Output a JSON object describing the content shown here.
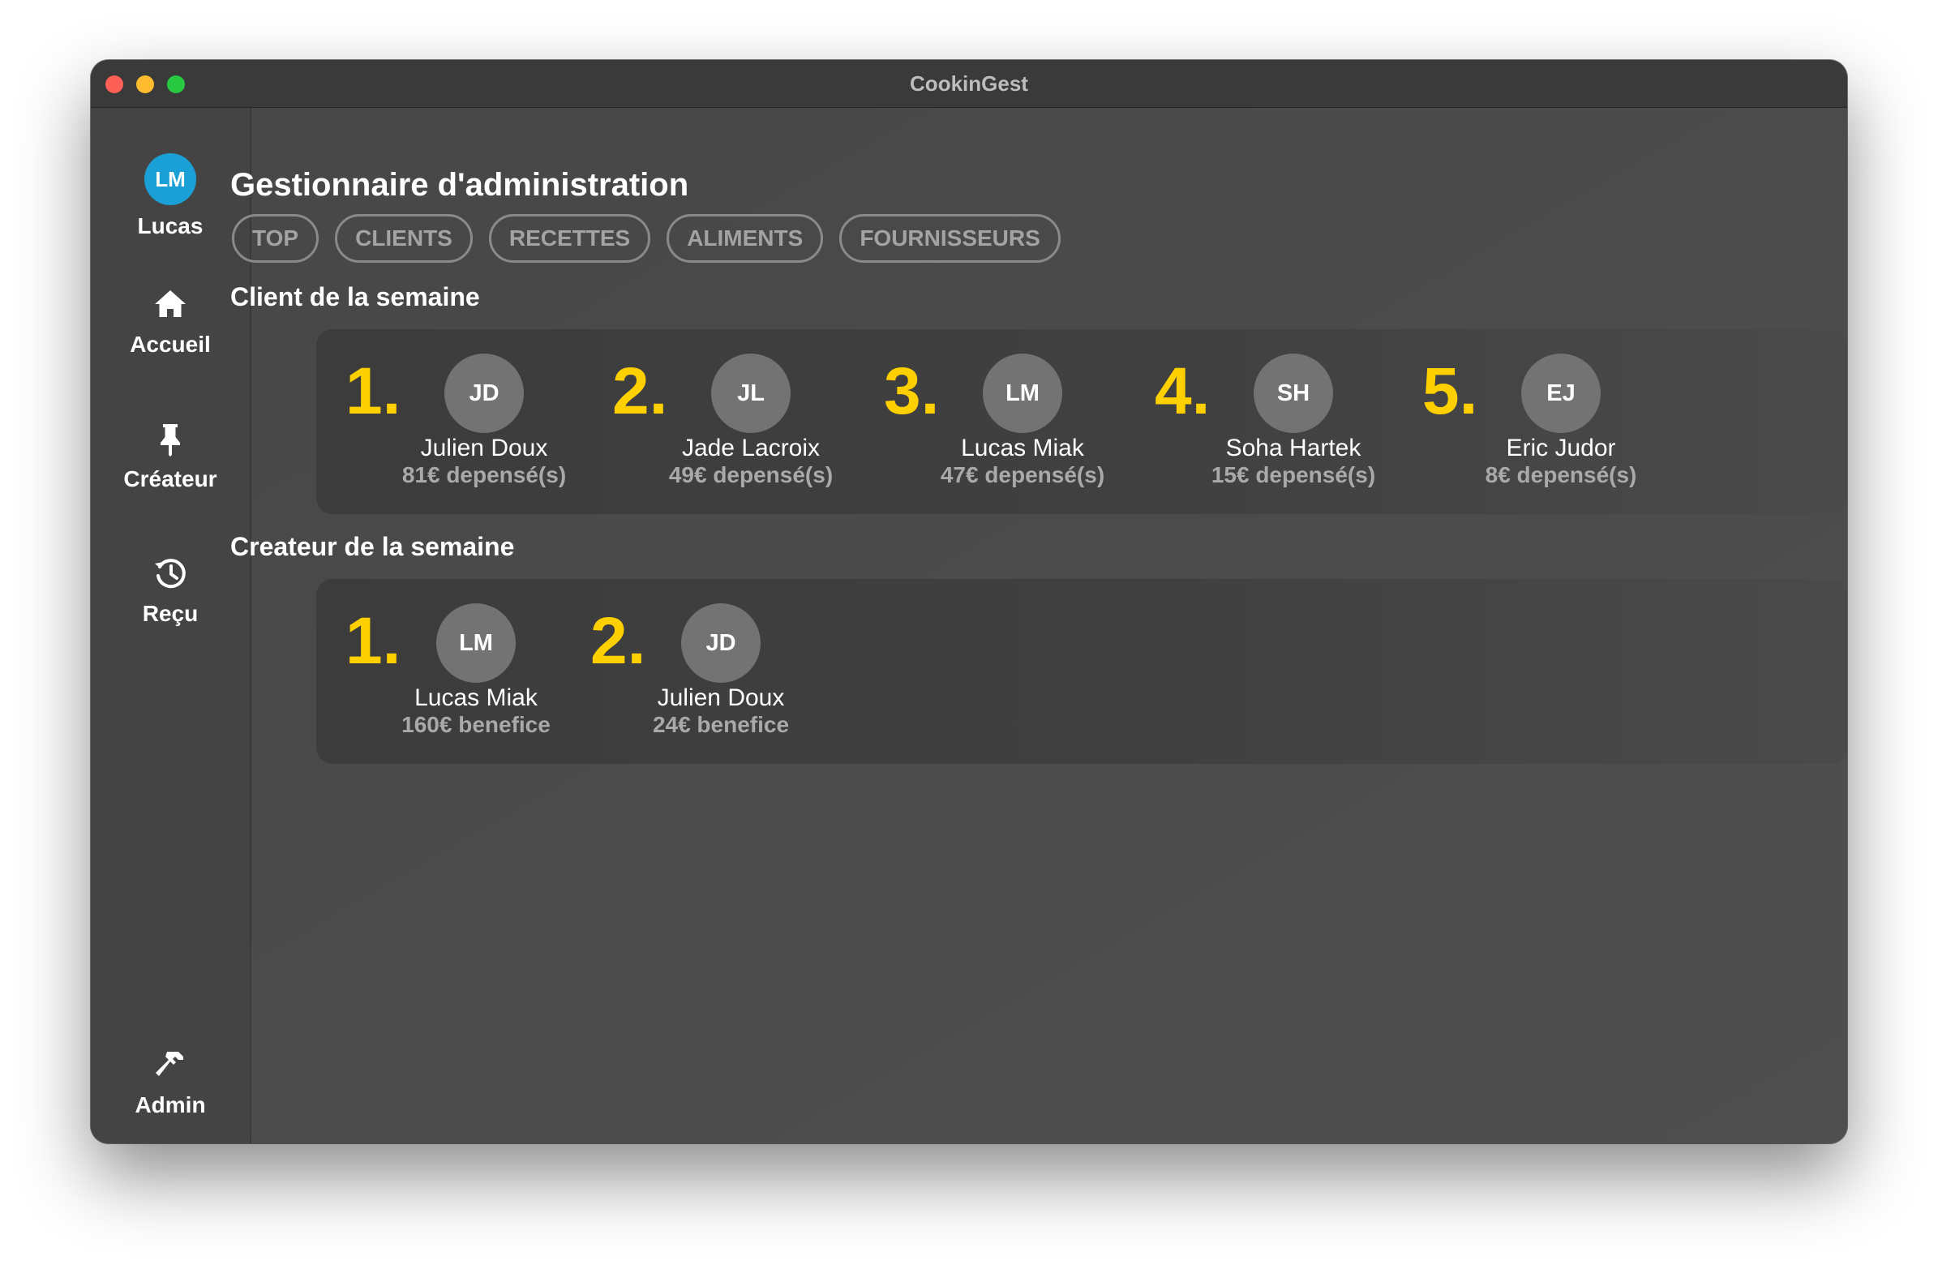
{
  "window": {
    "title": "CookinGest"
  },
  "sidebar": {
    "user": {
      "initials": "LM",
      "name": "Lucas",
      "avatar_color": "#1a9fd6"
    },
    "items": [
      {
        "label": "Accueil",
        "icon": "home-icon"
      },
      {
        "label": "Créateur",
        "icon": "pin-icon"
      },
      {
        "label": "Reçu",
        "icon": "history-icon"
      }
    ],
    "admin": {
      "label": "Admin",
      "icon": "hammer-icon"
    }
  },
  "main": {
    "title": "Gestionnaire d'administration",
    "tabs": [
      "TOP",
      "CLIENTS",
      "RECETTES",
      "ALIMENTS",
      "FOURNISSEURS"
    ],
    "clients_section": {
      "title": "Client de la semaine",
      "entries": [
        {
          "rank": "1.",
          "initials": "JD",
          "name": "Julien Doux",
          "stat": "81€ depensé(s)"
        },
        {
          "rank": "2.",
          "initials": "JL",
          "name": "Jade Lacroix",
          "stat": "49€ depensé(s)"
        },
        {
          "rank": "3.",
          "initials": "LM",
          "name": "Lucas Miak",
          "stat": "47€ depensé(s)"
        },
        {
          "rank": "4.",
          "initials": "SH",
          "name": "Soha Hartek",
          "stat": "15€ depensé(s)"
        },
        {
          "rank": "5.",
          "initials": "EJ",
          "name": "Eric Judor",
          "stat": "8€ depensé(s)"
        }
      ]
    },
    "creators_section": {
      "title": "Createur de la semaine",
      "entries": [
        {
          "rank": "1.",
          "initials": "LM",
          "name": "Lucas Miak",
          "stat": "160€ benefice"
        },
        {
          "rank": "2.",
          "initials": "JD",
          "name": "Julien Doux",
          "stat": "24€ benefice"
        }
      ]
    }
  },
  "colors": {
    "rank": "#ffd000",
    "avatar": "#737373",
    "background": "#4a4a4a"
  }
}
